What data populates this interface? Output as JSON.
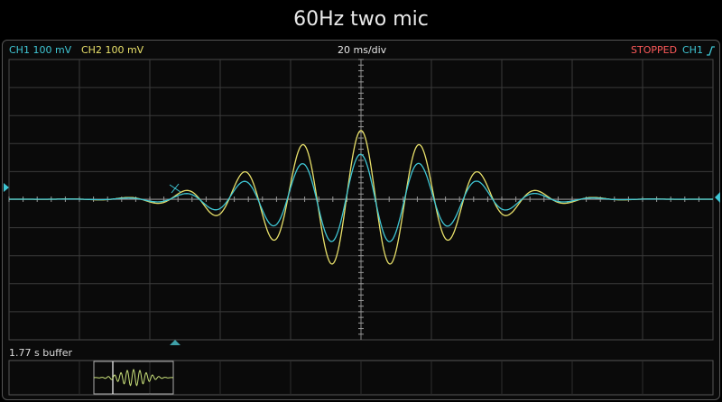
{
  "title": "60Hz two mic",
  "header": {
    "ch1_label": "CH1 100 mV",
    "ch2_label": "CH2 100 mV",
    "timebase": "20 ms/div",
    "status": "STOPPED",
    "trigger_source": "CH1",
    "trigger_icon": "rising-edge-icon"
  },
  "buffer": {
    "label": "1.77 s buffer"
  },
  "colors": {
    "ch1": "#3fc6d4",
    "ch2": "#e8e06a",
    "grid": "#3a3a3a",
    "status": "#ff5a5a"
  },
  "waveform": {
    "frequency_hz": 60,
    "time_per_div_ms": 20,
    "volts_per_div_mv": 100,
    "ch1_peak_divisions": 1.6,
    "ch2_peak_divisions": 2.45
  }
}
